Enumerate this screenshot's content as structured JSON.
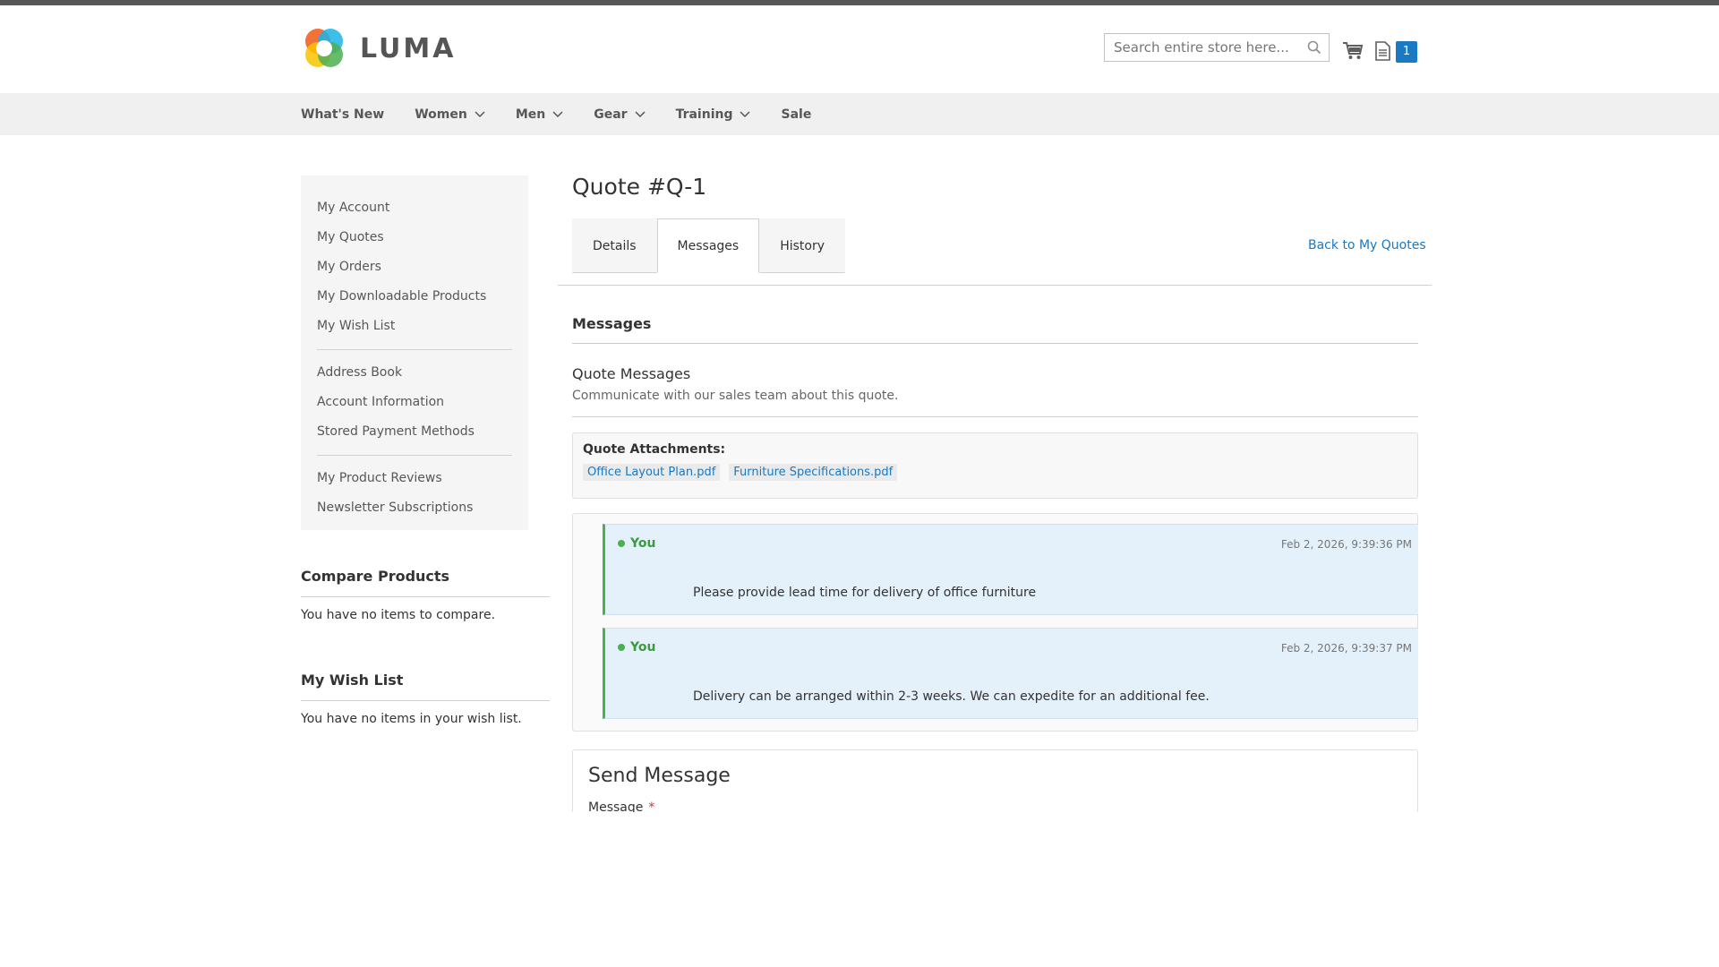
{
  "header": {
    "logo_text": "LUMA",
    "search_placeholder": "Search entire store here...",
    "quote_count": "1"
  },
  "nav": {
    "items": [
      {
        "label": "What's New",
        "dropdown": false
      },
      {
        "label": "Women",
        "dropdown": true
      },
      {
        "label": "Men",
        "dropdown": true
      },
      {
        "label": "Gear",
        "dropdown": true
      },
      {
        "label": "Training",
        "dropdown": true
      },
      {
        "label": "Sale",
        "dropdown": false
      }
    ]
  },
  "sidebar": {
    "group1": [
      "My Account",
      "My Quotes",
      "My Orders",
      "My Downloadable Products",
      "My Wish List"
    ],
    "group2": [
      "Address Book",
      "Account Information",
      "Stored Payment Methods"
    ],
    "group3": [
      "My Product Reviews",
      "Newsletter Subscriptions"
    ]
  },
  "compare": {
    "title": "Compare Products",
    "text": "You have no items to compare."
  },
  "wishlist": {
    "title": "My Wish List",
    "text": "You have no items in your wish list."
  },
  "main": {
    "page_title": "Quote #Q-1",
    "tabs": [
      "Details",
      "Messages",
      "History"
    ],
    "active_tab": "Messages",
    "back_link": "Back to My Quotes",
    "section_title": "Messages",
    "qm_title": "Quote Messages",
    "qm_subtitle": "Communicate with our sales team about this quote.",
    "attachments_label": "Quote Attachments:",
    "attachments": [
      "Office Layout Plan.pdf",
      "Furniture Specifications.pdf"
    ],
    "messages": [
      {
        "author": "You",
        "time": "Feb 2, 2026, 9:39:36 PM",
        "text": "Please provide lead time for delivery of office furniture"
      },
      {
        "author": "You",
        "time": "Feb 2, 2026, 9:39:37 PM",
        "text": "Delivery can be arranged within 2-3 weeks. We can expedite for an additional fee."
      }
    ],
    "send_title": "Send Message",
    "message_label": "Message",
    "required_mark": "*"
  },
  "colors": {
    "accent": "#1979c3",
    "message_border": "#4caf50",
    "message_bg": "#e4f0fa"
  }
}
